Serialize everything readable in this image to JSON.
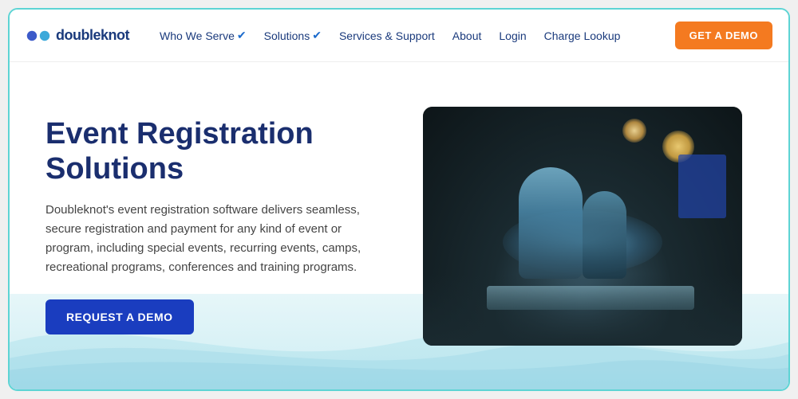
{
  "logo": {
    "text": "doubleknot",
    "alt": "Doubleknot logo"
  },
  "nav": {
    "links": [
      {
        "label": "Who We Serve",
        "hasDropdown": true
      },
      {
        "label": "Solutions",
        "hasDropdown": true
      },
      {
        "label": "Services & Support",
        "hasDropdown": false
      },
      {
        "label": "About",
        "hasDropdown": false
      },
      {
        "label": "Login",
        "hasDropdown": false
      },
      {
        "label": "Charge Lookup",
        "hasDropdown": false
      }
    ],
    "cta": "GET A DEMO"
  },
  "hero": {
    "title": "Event Registration Solutions",
    "description": "Doubleknot's event registration software delivers seamless, secure registration and payment for any kind of event or program, including special events, recurring events, camps, recreational programs, conferences and training programs.",
    "button": "REQUEST A DEMO",
    "image_alt": "Two people examining an exhibit display"
  }
}
